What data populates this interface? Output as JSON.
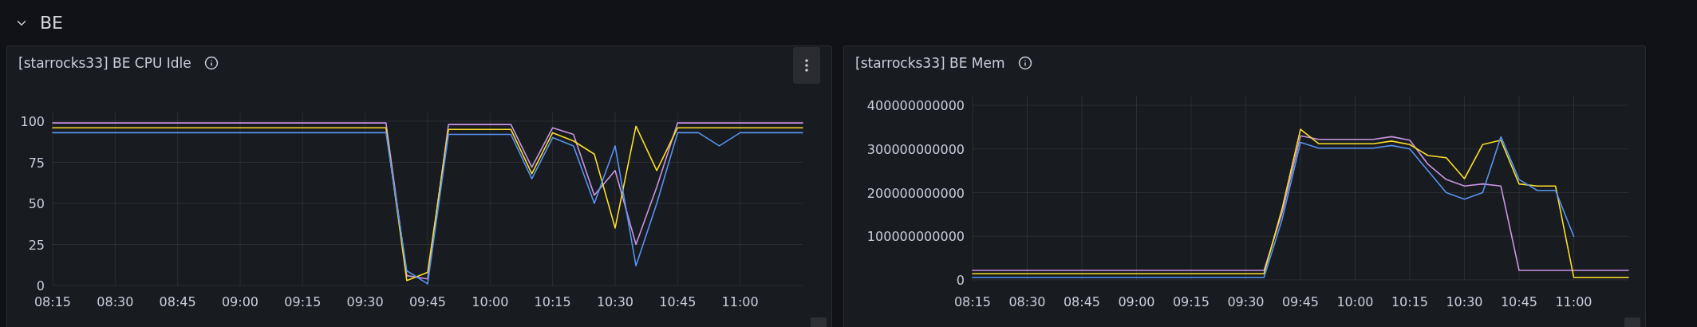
{
  "row": {
    "title": "BE",
    "expanded": true
  },
  "panels": [
    {
      "title": "[starrocks33] BE CPU Idle",
      "menu_visible": true,
      "chart_data": {
        "type": "line",
        "grid": true,
        "ylim": [
          0,
          100
        ],
        "categories": [
          "08:15",
          null,
          null,
          "08:30",
          null,
          null,
          "08:45",
          null,
          null,
          "09:00",
          null,
          null,
          "09:15",
          null,
          null,
          "09:30",
          null,
          null,
          "09:45",
          null,
          null,
          "10:00",
          null,
          null,
          "10:15",
          null,
          null,
          "10:30",
          null,
          null,
          "10:45",
          null,
          null,
          "11:00",
          null,
          null,
          null
        ],
        "yticks": [
          0,
          25,
          50,
          75,
          100
        ],
        "series": [
          {
            "color": "#ca95e5",
            "values": [
              99,
              99,
              99,
              99,
              99,
              99,
              99,
              99,
              99,
              99,
              99,
              99,
              99,
              99,
              99,
              99,
              99,
              6,
              4,
              98,
              98,
              98,
              98,
              72,
              96,
              92,
              55,
              70,
              25,
              60,
              99,
              99,
              99,
              99,
              99,
              99,
              99
            ]
          },
          {
            "color": "#fade2a",
            "values": [
              96,
              96,
              96,
              96,
              96,
              96,
              96,
              96,
              96,
              96,
              96,
              96,
              96,
              96,
              96,
              96,
              96,
              3,
              8,
              95,
              95,
              95,
              95,
              68,
              93,
              88,
              80,
              35,
              97,
              70,
              96,
              96,
              96,
              96,
              96,
              96,
              96
            ]
          },
          {
            "color": "#5794f2",
            "values": [
              93,
              93,
              93,
              93,
              93,
              93,
              93,
              93,
              93,
              93,
              93,
              93,
              93,
              93,
              93,
              93,
              93,
              9,
              1,
              92,
              92,
              92,
              92,
              65,
              90,
              85,
              50,
              85,
              12,
              50,
              93,
              93,
              85,
              93,
              93,
              93,
              93
            ]
          }
        ]
      }
    },
    {
      "title": "[starrocks33] BE Mem",
      "menu_visible": false,
      "chart_data": {
        "type": "line",
        "grid": true,
        "ylim": [
          0,
          400000000000
        ],
        "categories": [
          "08:15",
          null,
          null,
          "08:30",
          null,
          null,
          "08:45",
          null,
          null,
          "09:00",
          null,
          null,
          "09:15",
          null,
          null,
          "09:30",
          null,
          null,
          "09:45",
          null,
          null,
          "10:00",
          null,
          null,
          "10:15",
          null,
          null,
          "10:30",
          null,
          null,
          "10:45",
          null,
          null,
          "11:00",
          null,
          null,
          null
        ],
        "yticks": [
          0,
          100000000000,
          200000000000,
          300000000000,
          400000000000
        ],
        "series": [
          {
            "color": "#ca95e5",
            "values": [
              22000000000,
              22000000000,
              22000000000,
              22000000000,
              22000000000,
              22000000000,
              22000000000,
              22000000000,
              22000000000,
              22000000000,
              22000000000,
              22000000000,
              22000000000,
              22000000000,
              22000000000,
              22000000000,
              22000000000,
              155000000000,
              330000000000,
              322000000000,
              322000000000,
              322000000000,
              322000000000,
              328000000000,
              320000000000,
              265000000000,
              230000000000,
              215000000000,
              220000000000,
              215000000000,
              22000000000,
              22000000000,
              22000000000,
              22000000000,
              22000000000,
              22000000000,
              22000000000
            ]
          },
          {
            "color": "#fade2a",
            "values": [
              14000000000,
              14000000000,
              14000000000,
              14000000000,
              14000000000,
              14000000000,
              14000000000,
              14000000000,
              14000000000,
              14000000000,
              14000000000,
              14000000000,
              14000000000,
              14000000000,
              14000000000,
              14000000000,
              14000000000,
              165000000000,
              345000000000,
              312000000000,
              312000000000,
              312000000000,
              312000000000,
              318000000000,
              310000000000,
              285000000000,
              280000000000,
              232000000000,
              310000000000,
              320000000000,
              220000000000,
              215000000000,
              215000000000,
              6000000000,
              6000000000,
              6000000000,
              6000000000
            ]
          },
          {
            "color": "#5794f2",
            "values": [
              6000000000,
              6000000000,
              6000000000,
              6000000000,
              6000000000,
              6000000000,
              6000000000,
              6000000000,
              6000000000,
              6000000000,
              6000000000,
              6000000000,
              6000000000,
              6000000000,
              6000000000,
              6000000000,
              6000000000,
              140000000000,
              315000000000,
              302000000000,
              302000000000,
              302000000000,
              302000000000,
              308000000000,
              300000000000,
              250000000000,
              200000000000,
              185000000000,
              200000000000,
              328000000000,
              230000000000,
              205000000000,
              205000000000,
              100000000000,
              null,
              null,
              null
            ]
          }
        ]
      }
    }
  ]
}
